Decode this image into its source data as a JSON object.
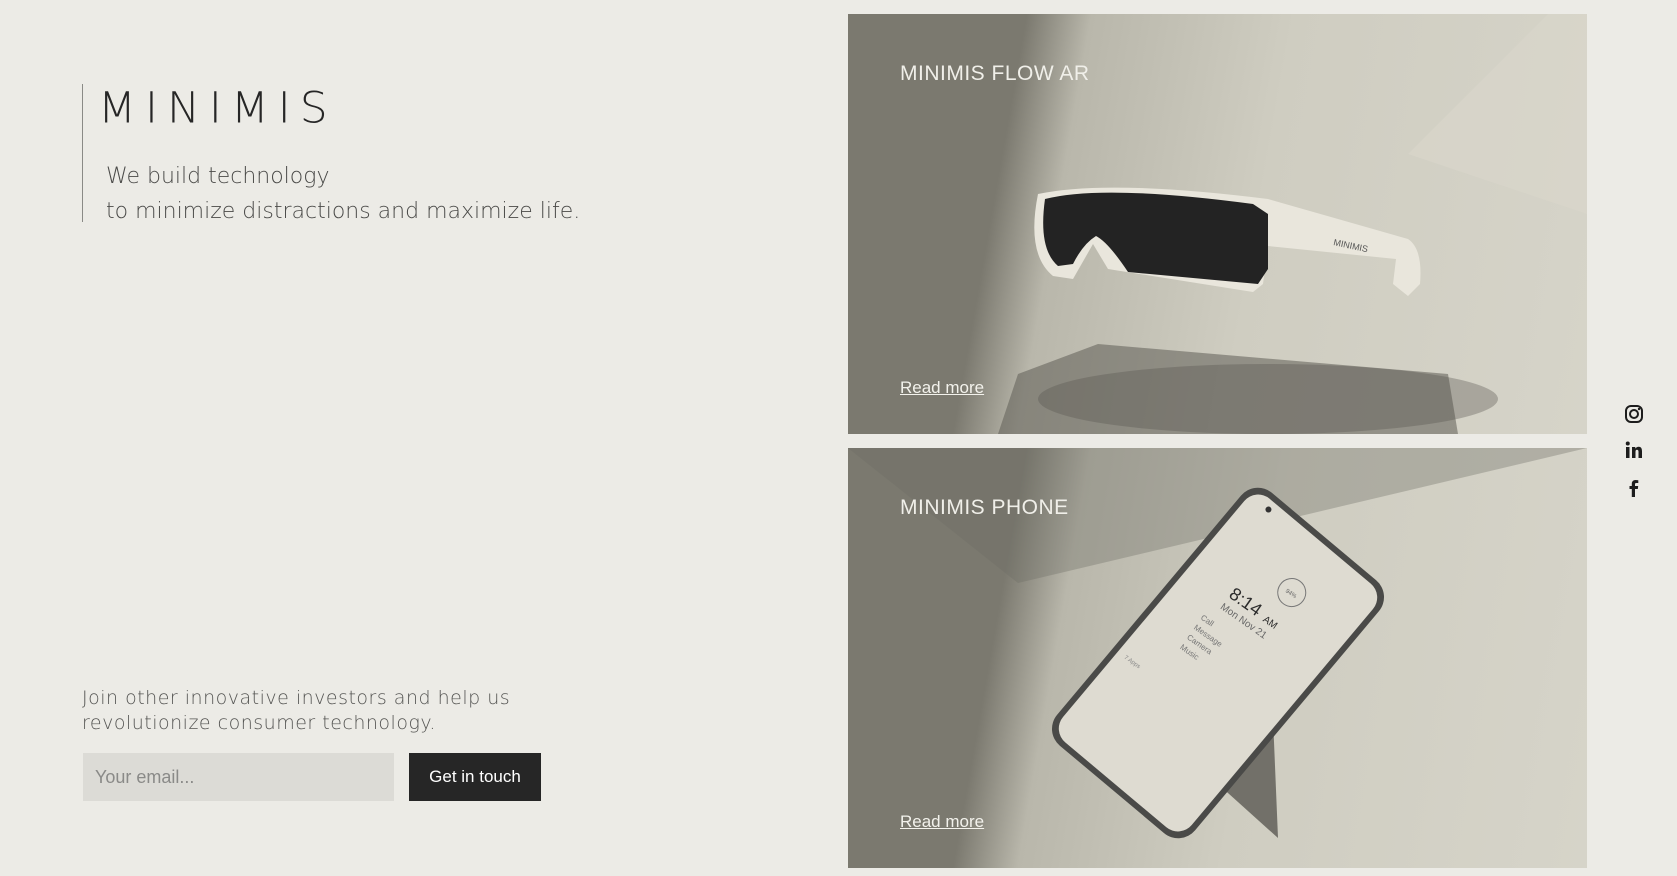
{
  "brand": {
    "logo": "MINIMIS",
    "tagline_line1": "We build technology",
    "tagline_line2": "to minimize distractions and maximize life."
  },
  "signup": {
    "text": "Join other innovative investors and help us revolutionize consumer technology.",
    "email_placeholder": "Your email...",
    "button_label": "Get in touch"
  },
  "products": [
    {
      "title": "MINIMIS FLOW AR",
      "link_label": "Read more",
      "icon": "ar-glasses-image",
      "glasses_brand": "MINIMIS"
    },
    {
      "title": "MINIMIS PHONE",
      "link_label": "Read more",
      "icon": "phone-image",
      "screen_time": "8:14",
      "screen_ampm": "AM",
      "screen_date": "Mon Nov 21",
      "screen_menu": [
        "Call",
        "Message",
        "Camera",
        "Music"
      ],
      "screen_apps": "7 Apps",
      "screen_badge": "94%"
    }
  ],
  "social": [
    {
      "name": "instagram-icon"
    },
    {
      "name": "linkedin-icon"
    },
    {
      "name": "facebook-icon"
    }
  ],
  "colors": {
    "background": "#ecebe6",
    "button": "#262626",
    "input": "#dcdbd6",
    "card_dark": "#7b796f",
    "card_light": "#d6d4c9"
  }
}
